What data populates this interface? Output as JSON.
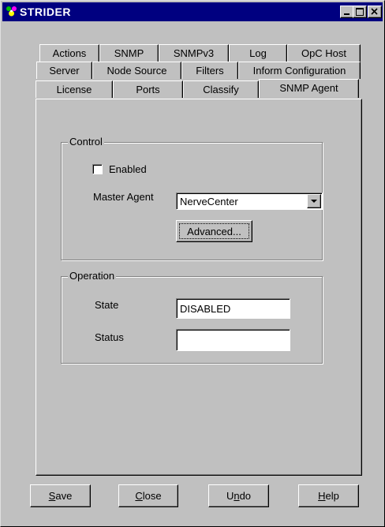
{
  "window": {
    "title": "STRIDER"
  },
  "tabs": {
    "row1": [
      "Actions",
      "SNMP",
      "SNMPv3",
      "Log",
      "OpC Host"
    ],
    "row2": [
      "Server",
      "Node Source",
      "Filters",
      "Inform Configuration"
    ],
    "row3": [
      "License",
      "Ports",
      "Classify",
      "SNMP Agent"
    ],
    "active": "SNMP Agent"
  },
  "control": {
    "group_label": "Control",
    "enabled_label": "Enabled",
    "enabled_checked": false,
    "master_agent_label": "Master Agent",
    "master_agent_value": "NerveCenter",
    "advanced_label": "Advanced..."
  },
  "operation": {
    "group_label": "Operation",
    "state_label": "State",
    "state_value": "DISABLED",
    "status_label": "Status",
    "status_value": ""
  },
  "buttons": {
    "save": {
      "mnemonic": "S",
      "rest": "ave"
    },
    "close": {
      "mnemonic": "C",
      "rest": "lose"
    },
    "undo": {
      "pre": "U",
      "mnemonic": "n",
      "rest": "do"
    },
    "help": {
      "mnemonic": "H",
      "rest": "elp"
    }
  }
}
